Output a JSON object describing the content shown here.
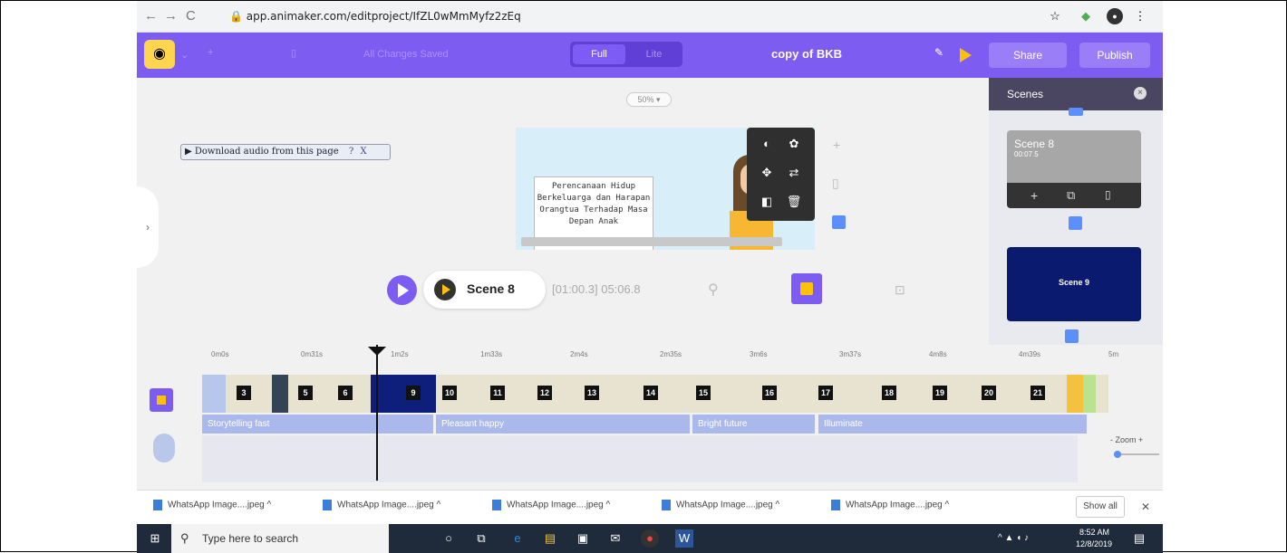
{
  "browser": {
    "url": "app.animaker.com/editproject/IfZL0wMmMyfz2zEq"
  },
  "topbar": {
    "status": "All Changes Saved",
    "mode_full": "Full",
    "mode_lite": "Lite",
    "project_name": "copy of BKB",
    "share_label": "Share",
    "publish_label": "Publish"
  },
  "stage": {
    "zoom": "50% ▾",
    "download_audio": "▶ Download audio from this page",
    "download_help": "?",
    "download_close": "X",
    "canvas_text": "Perencanaan Hidup Berkeluarga dan Harapan Orangtua Terhadap Masa Depan Anak",
    "current_scene": "Scene 8",
    "time": "[01:00.3] 05:06.8"
  },
  "scenes_panel": {
    "title": "Scenes",
    "close": "×",
    "scene8": {
      "name": "Scene 8",
      "duration": "00:07.5"
    },
    "scene9": {
      "name": "Scene 9"
    }
  },
  "timeline": {
    "ticks": [
      "0m0s",
      "0m31s",
      "1m2s",
      "1m33s",
      "2m4s",
      "2m35s",
      "3m6s",
      "3m37s",
      "4m8s",
      "4m39s",
      "5m"
    ],
    "scenes": [
      "3",
      "5",
      "6",
      "9",
      "10",
      "11",
      "12",
      "13",
      "14",
      "15",
      "16",
      "17",
      "18",
      "19",
      "20",
      "21"
    ],
    "music": [
      "Storytelling fast",
      "Pleasant happy",
      "Bright future",
      "Illuminate"
    ],
    "zoom_label": "- Zoom +"
  },
  "downloads": {
    "items": [
      "WhatsApp Image....jpeg",
      "WhatsApp Image....jpeg",
      "WhatsApp Image....jpeg",
      "WhatsApp Image....jpeg",
      "WhatsApp Image....jpeg"
    ],
    "show_all": "Show all",
    "close": "✕"
  },
  "taskbar": {
    "search_placeholder": "Type here to search",
    "time": "8:52 AM",
    "date": "12/8/2019"
  },
  "colors": {
    "accent": "#7d5cf2",
    "play": "#ffc107"
  }
}
